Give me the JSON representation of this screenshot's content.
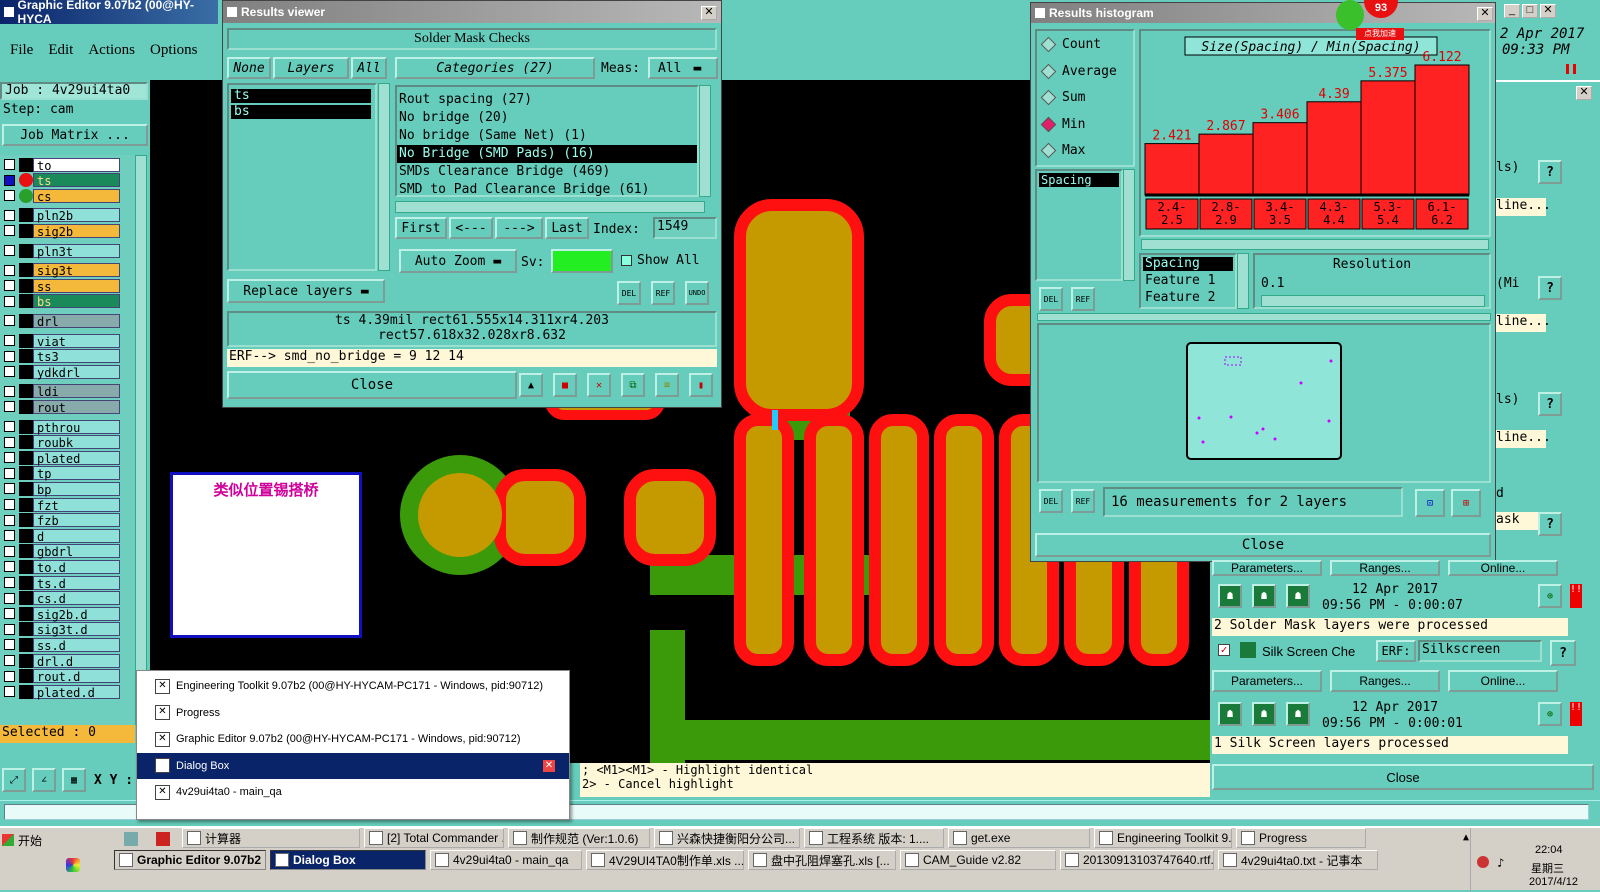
{
  "main_window": {
    "title": "Graphic Editor 9.07b2 (00@HY-HYCA",
    "menu": [
      "File",
      "Edit",
      "Actions",
      "Options"
    ],
    "job": "Job : 4v29ui4ta0",
    "step": "Step: cam",
    "job_matrix": "Job Matrix ...",
    "layers": [
      "to",
      "ts",
      "cs",
      "pln2b",
      "sig2b",
      "pln3t",
      "sig3t",
      "ss",
      "bs",
      "drl",
      "viat",
      "ts3",
      "ydkdrl",
      "ldi",
      "rout",
      "pthrou",
      "roubk",
      "plated",
      "tp",
      "bp",
      "fzt",
      "fzb",
      "d",
      "gbdrl",
      "to.d",
      "ts.d",
      "cs.d",
      "sig2b.d",
      "sig3t.d",
      "ss.d",
      "drl.d",
      "rout.d",
      "plated.d"
    ],
    "selected": "Selected : 0",
    "xy_label": "X Y :",
    "status_line1": "; <M1><M1> - Highlight identical",
    "status_line2": "2> - Cancel highlight",
    "annotation": "类似位置锡搭桥"
  },
  "results_viewer": {
    "title": "Results viewer",
    "header": "Solder Mask Checks",
    "none_label": "None",
    "layers_label": "Layers",
    "all_label": "All",
    "categories_label": "Categories (27)",
    "meas_label": "Meas:",
    "meas_value": "All",
    "layer_list": [
      "ts",
      "bs"
    ],
    "categories": [
      "Rout spacing (27)",
      "No bridge (20)",
      "No bridge (Same Net) (1)",
      "No Bridge (SMD Pads) (16)",
      "SMDs Clearance Bridge (469)",
      "SMD to Pad Clearance Bridge (61)"
    ],
    "first": "First",
    "prev": "<---",
    "next": "--->",
    "last": "Last",
    "index_label": "Index:",
    "index_value": "1549",
    "auto_zoom": "Auto Zoom",
    "sv_label": "Sv:",
    "show_all": "Show All",
    "replace_layers": "Replace layers",
    "del": "DEL",
    "ref": "REF",
    "undo": "UNDO",
    "info_line1": "ts 4.39mil  rect61.555x14.311xr4.203",
    "info_line2": "rect57.618x32.028xr8.632",
    "erf_line": "ERF--> smd_no_bridge = 9 12 14",
    "close": "Close"
  },
  "histogram": {
    "title": "Results histogram",
    "options": [
      "Count",
      "Average",
      "Sum",
      "Min",
      "Max"
    ],
    "selected_option": "Min",
    "chart_title": "Size(Spacing) / Min(Spacing)",
    "list_item": "Spacing",
    "spacing_list": [
      "Spacing",
      "Feature 1",
      "Feature 2"
    ],
    "resolution_label": "Resolution",
    "resolution_value": "0.1",
    "measurements": "16 measurements for 2 layers",
    "del": "DEL",
    "ref": "REF",
    "close": "Close"
  },
  "chart_data": {
    "type": "bar",
    "title": "Size(Spacing) / Min(Spacing)",
    "categories": [
      "2.4-2.5",
      "2.8-2.9",
      "3.4-3.5",
      "4.3-4.4",
      "5.3-5.4",
      "6.1-6.2"
    ],
    "values": [
      2.421,
      2.867,
      3.406,
      4.39,
      5.375,
      6.122
    ],
    "value_labels": [
      "2.421",
      "2.867",
      "3.406",
      "4.39",
      "5.375",
      "6.122"
    ],
    "category_lines": [
      [
        "2.4-",
        "2.5"
      ],
      [
        "2.8-",
        "2.9"
      ],
      [
        "3.4-",
        "3.5"
      ],
      [
        "4.3-",
        "4.4"
      ],
      [
        "5.3-",
        "5.4"
      ],
      [
        "6.1-",
        "6.2"
      ]
    ],
    "ylim": [
      0,
      6.122
    ],
    "bar_color": "#ff2222"
  },
  "right_panel": {
    "date": "2 Apr 2017",
    "time": "09:33 PM",
    "partial_labels": [
      "ls)",
      "line...",
      "(Mi",
      "line...",
      "ls)",
      "line...",
      "d",
      "ask"
    ],
    "params": "Parameters...",
    "ranges": "Ranges...",
    "online": "Online...",
    "solder_date": "12 Apr 2017",
    "solder_time": "09:56 PM - 0:00:07",
    "solder_status": "2 Solder Mask layers were processed",
    "silk_label": "Silk Screen Che",
    "erf_label": "ERF:",
    "erf_value": "Silkscreen",
    "silk_date": "12 Apr 2017",
    "silk_time": "09:56 PM - 0:00:01",
    "silk_status": "1 Silk Screen layers processed",
    "close": "Close",
    "badge": "93",
    "badge_text": "点我加速"
  },
  "popup": {
    "items": [
      "Engineering Toolkit 9.07b2 (00@HY-HYCAM-PC171 - Windows, pid:90712)",
      "Progress",
      "Graphic Editor 9.07b2 (00@HY-HYCAM-PC171 - Windows, pid:90712)",
      "Dialog Box",
      "4v29ui4ta0 - main_qa"
    ],
    "selected_index": 3
  },
  "taskbar": {
    "start": "开始",
    "row1": [
      "计算器",
      "[2] Total Commander ...",
      "制作规范 (Ver:1.0.6)",
      "兴森快捷衡阳分公司...",
      "工程系统  版本: 1....",
      "get.exe",
      "Engineering Toolkit 9....",
      "Progress"
    ],
    "row2": [
      "Graphic Editor 9.07b2 ...",
      "Dialog Box",
      "4v29ui4ta0 - main_qa",
      "4V29UI4TA0制作单.xls ...",
      "盘中孔阻焊塞孔.xls [...",
      "CAM_Guide v2.82",
      "20130913103747640.rtf...",
      "4v29ui4ta0.txt - 记事本"
    ],
    "clock": "22:04",
    "weekday": "星期三",
    "date": "2017/4/12"
  }
}
